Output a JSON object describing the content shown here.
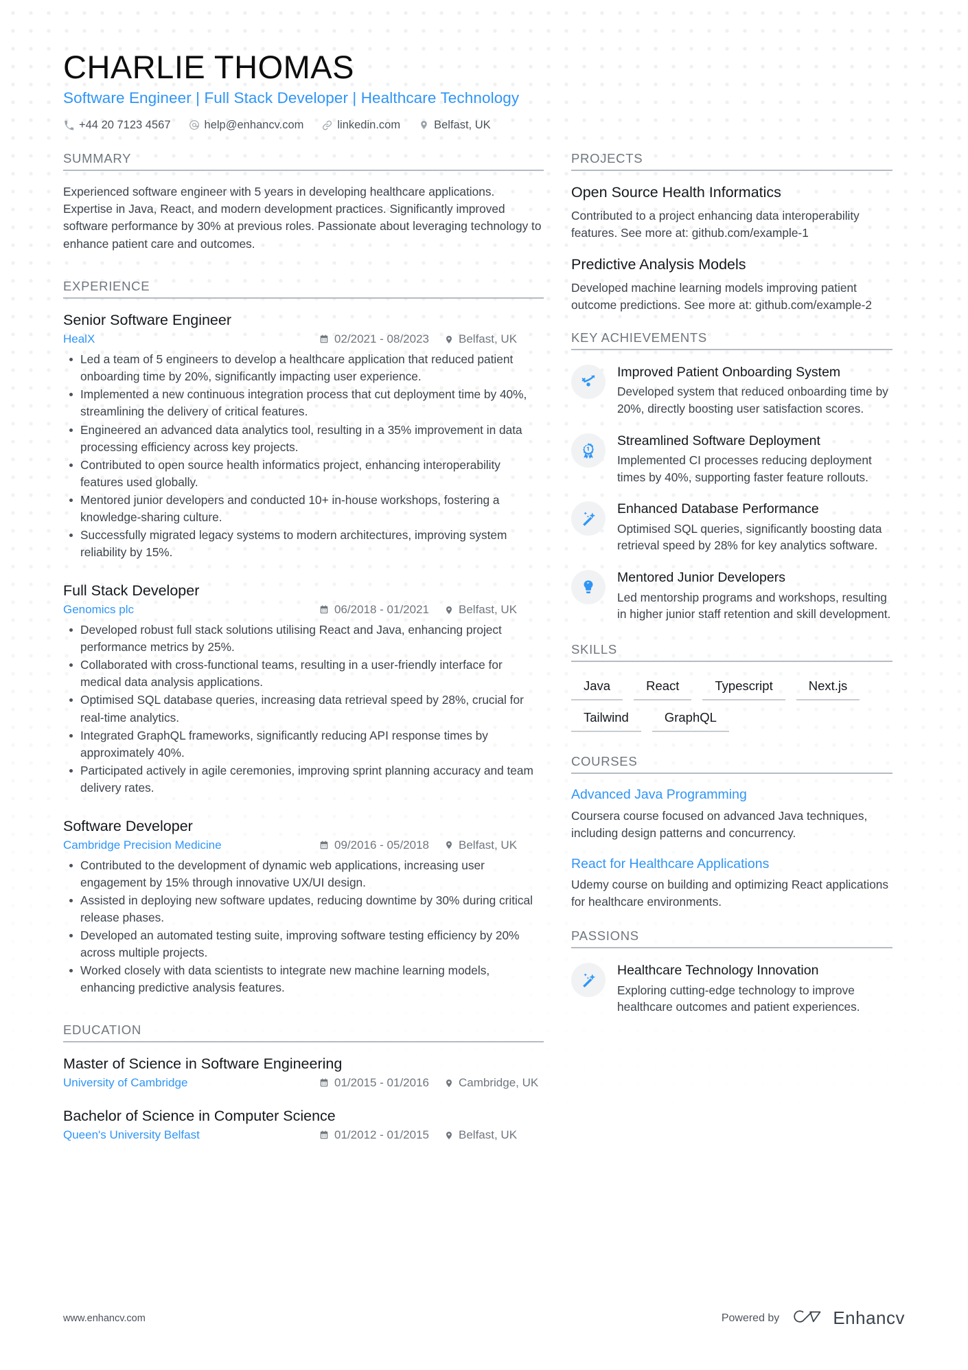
{
  "header": {
    "name": "CHARLIE THOMAS",
    "headline": "Software Engineer | Full Stack Developer | Healthcare Technology",
    "contacts": [
      {
        "icon": "phone-icon",
        "text": "+44 20 7123 4567"
      },
      {
        "icon": "email-icon",
        "text": "help@enhancv.com"
      },
      {
        "icon": "link-icon",
        "text": "linkedin.com"
      },
      {
        "icon": "location-pin-icon",
        "text": "Belfast, UK"
      }
    ]
  },
  "left": {
    "summary": {
      "section_title": "SUMMARY",
      "text": "Experienced software engineer with 5 years in developing healthcare applications. Expertise in Java, React, and modern development practices. Significantly improved software performance by 30% at previous roles. Passionate about leveraging technology to enhance patient care and outcomes."
    },
    "experience": {
      "section_title": "EXPERIENCE",
      "entries": [
        {
          "title": "Senior Software Engineer",
          "org": "HealX",
          "dates": "02/2021 - 08/2023",
          "location": "Belfast, UK",
          "bullets": [
            "Led a team of 5 engineers to develop a healthcare application that reduced patient onboarding time by 20%, significantly impacting user experience.",
            "Implemented a new continuous integration process that cut deployment time by 40%, streamlining the delivery of critical features.",
            "Engineered an advanced data analytics tool, resulting in a 35% improvement in data processing efficiency across key projects.",
            "Contributed to open source health informatics project, enhancing interoperability features used globally.",
            "Mentored junior developers and conducted 10+ in-house workshops, fostering a knowledge-sharing culture.",
            "Successfully migrated legacy systems to modern architectures, improving system reliability by 15%."
          ]
        },
        {
          "title": "Full Stack Developer",
          "org": "Genomics plc",
          "dates": "06/2018 - 01/2021",
          "location": "Belfast, UK",
          "bullets": [
            "Developed robust full stack solutions utilising React and Java, enhancing project performance metrics by 25%.",
            "Collaborated with cross-functional teams, resulting in a user-friendly interface for medical data analysis applications.",
            "Optimised SQL database queries, increasing data retrieval speed by 28%, crucial for real-time analytics.",
            "Integrated GraphQL frameworks, significantly reducing API response times by approximately 40%.",
            "Participated actively in agile ceremonies, improving sprint planning accuracy and team delivery rates."
          ]
        },
        {
          "title": "Software Developer",
          "org": "Cambridge Precision Medicine",
          "dates": "09/2016 - 05/2018",
          "location": "Belfast, UK",
          "bullets": [
            "Contributed to the development of dynamic web applications, increasing user engagement by 15% through innovative UX/UI design.",
            "Assisted in deploying new software updates, reducing downtime by 30% during critical release phases.",
            "Developed an automated testing suite, improving software testing efficiency by 20% across multiple projects.",
            "Worked closely with data scientists to integrate new machine learning models, enhancing predictive analysis features."
          ]
        }
      ]
    },
    "education": {
      "section_title": "EDUCATION",
      "entries": [
        {
          "title": "Master of Science in Software Engineering",
          "org": "University of Cambridge",
          "dates": "01/2015 - 01/2016",
          "location": "Cambridge, UK"
        },
        {
          "title": "Bachelor of Science in Computer Science",
          "org": "Queen's University Belfast",
          "dates": "01/2012 - 01/2015",
          "location": "Belfast, UK"
        }
      ]
    }
  },
  "right": {
    "projects": {
      "section_title": "PROJECTS",
      "items": [
        {
          "title": "Open Source Health Informatics",
          "description": "Contributed to a project enhancing data interoperability features. See more at: github.com/example-1"
        },
        {
          "title": "Predictive Analysis Models",
          "description": "Developed machine learning models improving patient outcome predictions. See more at: github.com/example-2"
        }
      ]
    },
    "achievements": {
      "section_title": "KEY ACHIEVEMENTS",
      "items": [
        {
          "icon": "trend-arrow-icon",
          "title": "Improved Patient Onboarding System",
          "description": "Developed system that reduced onboarding time by 20%, directly boosting user satisfaction scores."
        },
        {
          "icon": "award-ribbon-icon",
          "title": "Streamlined Software Deployment",
          "description": "Implemented CI processes reducing deployment times by 40%, supporting faster feature rollouts."
        },
        {
          "icon": "magic-wand-icon",
          "title": "Enhanced Database Performance",
          "description": "Optimised SQL queries, significantly boosting data retrieval speed by 28% for key analytics software."
        },
        {
          "icon": "brain-icon",
          "title": "Mentored Junior Developers",
          "description": "Led mentorship programs and workshops, resulting in higher junior staff retention and skill development."
        }
      ]
    },
    "skills": {
      "section_title": "SKILLS",
      "items": [
        "Java",
        "React",
        "Typescript",
        "Next.js",
        "Tailwind",
        "GraphQL"
      ]
    },
    "courses": {
      "section_title": "COURSES",
      "items": [
        {
          "title": "Advanced Java Programming",
          "description": "Coursera course focused on advanced Java techniques, including design patterns and concurrency."
        },
        {
          "title": "React for Healthcare Applications",
          "description": "Udemy course on building and optimizing React applications for healthcare environments."
        }
      ]
    },
    "passions": {
      "section_title": "PASSIONS",
      "items": [
        {
          "icon": "magic-wand-icon",
          "title": "Healthcare Technology Innovation",
          "description": "Exploring cutting-edge technology to improve healthcare outcomes and patient experiences."
        }
      ]
    }
  },
  "footer": {
    "url": "www.enhancv.com",
    "powered_by": "Powered by",
    "brand": "Enhancv"
  },
  "colors": {
    "accent_blue": "#2f95f5",
    "heading_gray": "#6f767d",
    "body_text": "#3c434b",
    "icon_circle_bg": "#f1f2f3"
  }
}
